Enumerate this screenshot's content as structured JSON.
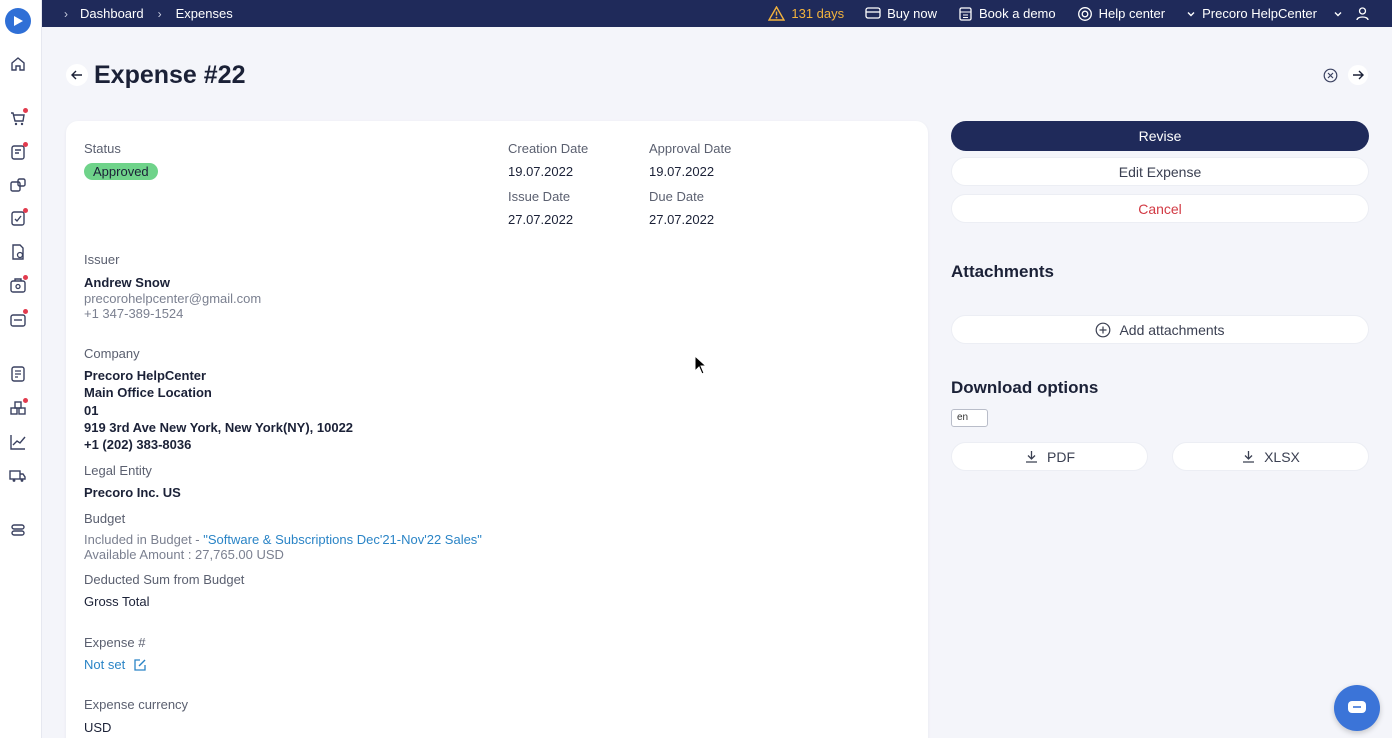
{
  "breadcrumb": {
    "items": [
      "Dashboard",
      "Expenses"
    ]
  },
  "topbar": {
    "trial_days": "131 days",
    "buy_now": "Buy now",
    "book_demo": "Book a demo",
    "help_center": "Help center",
    "company": "Precoro HelpCenter"
  },
  "page": {
    "title": "Expense #22"
  },
  "details": {
    "status_label": "Status",
    "status_value": "Approved",
    "creation_date_label": "Creation Date",
    "creation_date": "19.07.2022",
    "approval_date_label": "Approval Date",
    "approval_date": "19.07.2022",
    "issue_date_label": "Issue Date",
    "issue_date": "27.07.2022",
    "due_date_label": "Due Date",
    "due_date": "27.07.2022",
    "issuer_label": "Issuer",
    "issuer_name": "Andrew Snow",
    "issuer_email": "precorohelpcenter@gmail.com",
    "issuer_phone": "+1 347-389-1524",
    "company_label": "Company",
    "company_name": "Precoro HelpCenter",
    "company_location": "Main Office Location",
    "company_code": "01",
    "company_address": "919 3rd Ave New York, New York(NY), 10022",
    "company_phone": "+1 (202) 383-8036",
    "legal_entity_label": "Legal Entity",
    "legal_entity": "Precoro Inc. US",
    "budget_label": "Budget",
    "budget_included_prefix": "Included in Budget -",
    "budget_name": "\"Software & Subscriptions Dec'21-Nov'22 Sales\"",
    "budget_available": "Available Amount : 27,765.00 USD",
    "deducted_label": "Deducted Sum from Budget",
    "deducted_value": "Gross Total",
    "expense_number_label": "Expense #",
    "expense_number_value": "Not set",
    "currency_label": "Expense currency",
    "currency_value": "USD"
  },
  "actions": {
    "revise": "Revise",
    "edit": "Edit Expense",
    "cancel": "Cancel"
  },
  "attachments": {
    "title": "Attachments",
    "add": "Add attachments"
  },
  "download": {
    "title": "Download options",
    "language": "en",
    "pdf": "PDF",
    "xlsx": "XLSX"
  },
  "colors": {
    "topbar": "#1f2a5a",
    "primary_button": "#1f2a5a",
    "status_badge": "#6fd38a",
    "link": "#2a84c6",
    "cancel": "#d23a44",
    "warning": "#f3b33d",
    "notification_dot": "#e23b4e"
  }
}
